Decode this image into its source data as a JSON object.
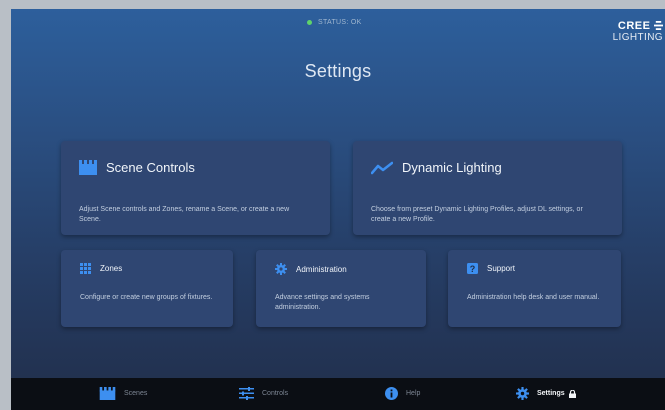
{
  "status": {
    "text": "STATUS: OK",
    "color": "#5fd36a"
  },
  "logo": {
    "main": "CREE",
    "symbol": "❒",
    "sub": "LIGHTING"
  },
  "page": {
    "title": "Settings"
  },
  "cards": {
    "scene_controls": {
      "title": "Scene Controls",
      "icon": "scene-icon",
      "description": "Adjust Scene controls and Zones, rename a Scene, or create a new Scene."
    },
    "dynamic_lighting": {
      "title": "Dynamic Lighting",
      "icon": "trend-line-icon",
      "description": "Choose from preset Dynamic Lighting Profiles, adjust DL settings, or create a new Profile."
    },
    "zones": {
      "title": "Zones",
      "icon": "grid-icon",
      "description": "Configure or create new groups of fixtures."
    },
    "administration": {
      "title": "Administration",
      "icon": "gear-icon",
      "description": "Advance settings and systems administration."
    },
    "support": {
      "title": "Support",
      "icon": "question-icon",
      "description": "Administration help desk and user manual."
    }
  },
  "nav": {
    "items": [
      {
        "label": "Scenes",
        "icon": "scene-icon",
        "active": false
      },
      {
        "label": "Controls",
        "icon": "sliders-icon",
        "active": false
      },
      {
        "label": "Help",
        "icon": "info-icon",
        "active": false
      },
      {
        "label": "Settings",
        "icon": "gear-icon",
        "active": true,
        "badge_icon": "lock-icon"
      }
    ]
  },
  "colors": {
    "accent": "#3d8ff0",
    "card_bg": "#2f4672",
    "nav_bg": "#0b0e14"
  }
}
